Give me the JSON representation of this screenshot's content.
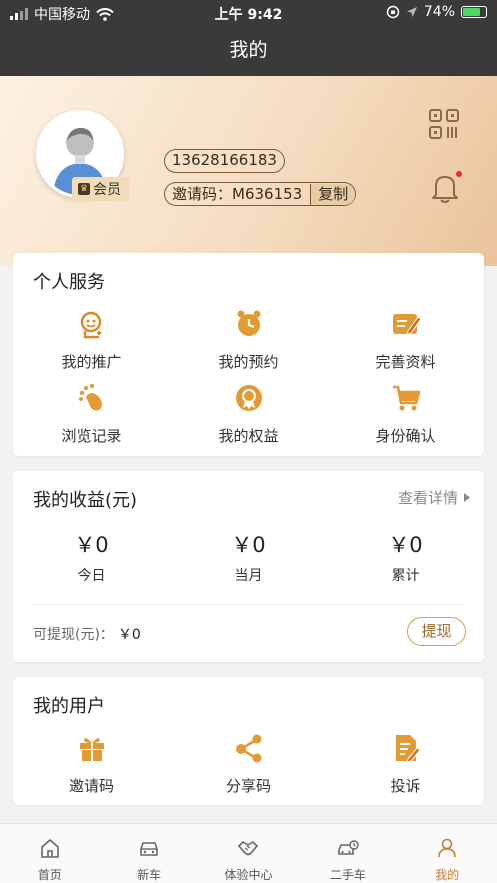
{
  "status_bar": {
    "carrier": "中国移动",
    "time": "上午 9:42",
    "battery": "74%"
  },
  "nav": {
    "title": "我的"
  },
  "profile": {
    "member_badge": "会员",
    "phone": "13628166183",
    "invite_label": "邀请码：M636153",
    "copy_label": "复制"
  },
  "service": {
    "title": "个人服务",
    "items": [
      {
        "label": "我的推广",
        "icon": "promotion-icon"
      },
      {
        "label": "我的预约",
        "icon": "alarm-clock-icon"
      },
      {
        "label": "完善资料",
        "icon": "edit-profile-icon"
      },
      {
        "label": "浏览记录",
        "icon": "footprint-icon"
      },
      {
        "label": "我的权益",
        "icon": "medal-icon"
      },
      {
        "label": "身份确认",
        "icon": "cart-icon"
      }
    ]
  },
  "earnings": {
    "title": "我的收益(元)",
    "more": "查看详情",
    "cols": [
      {
        "value": "￥0",
        "label": "今日"
      },
      {
        "value": "￥0",
        "label": "当月"
      },
      {
        "value": "￥0",
        "label": "累计"
      }
    ],
    "withdrawable_label": "可提现(元)：",
    "withdrawable_value": "￥0",
    "withdraw_button": "提现"
  },
  "users": {
    "title": "我的用户",
    "items": [
      {
        "label": "邀请码",
        "icon": "gift-icon"
      },
      {
        "label": "分享码",
        "icon": "share-icon"
      },
      {
        "label": "投诉",
        "icon": "complaint-icon"
      }
    ]
  },
  "tabbar": {
    "items": [
      {
        "label": "首页",
        "icon": "home-icon"
      },
      {
        "label": "新车",
        "icon": "car-icon"
      },
      {
        "label": "体验中心",
        "icon": "handshake-icon"
      },
      {
        "label": "二手车",
        "icon": "used-car-icon"
      },
      {
        "label": "我的",
        "icon": "user-icon"
      }
    ],
    "active_index": 4
  },
  "colors": {
    "accent": "#d98a26",
    "header_dark": "#3a3a3a",
    "active_tab": "#c87d2f"
  }
}
